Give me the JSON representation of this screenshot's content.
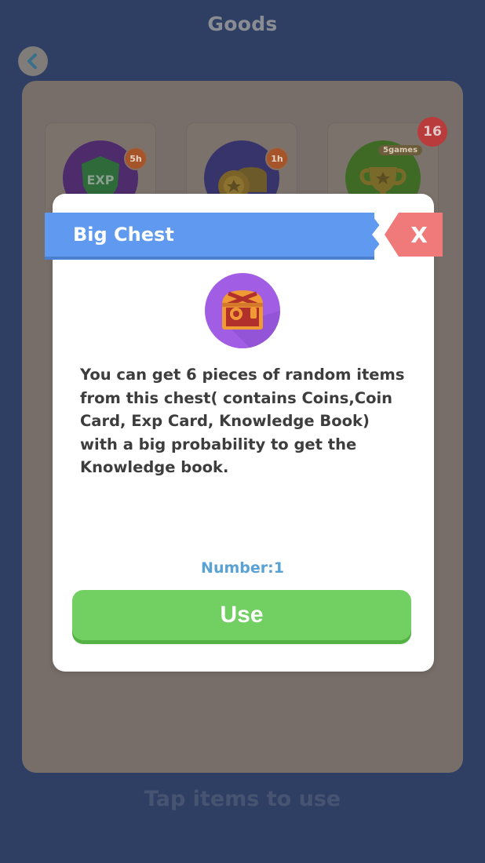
{
  "header": {
    "title": "Goods"
  },
  "goods": [
    {
      "icon": "exp-card-icon",
      "label": "EXP",
      "badge": "5h",
      "color": "#4e2b6a"
    },
    {
      "icon": "coin-card-icon",
      "badge": "1h",
      "color": "#37346b"
    },
    {
      "icon": "trophy-icon",
      "badge": "5games",
      "count": "16",
      "color": "#3f6a26"
    }
  ],
  "modal": {
    "title": "Big Chest",
    "close_label": "X",
    "icon": "treasure-chest-icon",
    "description": "You can get 6 pieces of random items from this chest( contains Coins,Coin Card, Exp Card, Knowledge Book) with a big probability to get the Knowledge book.",
    "number_label": "Number:1",
    "use_label": "Use"
  },
  "footer": {
    "hint": "Tap items to use"
  },
  "colors": {
    "background": "#2f3f63",
    "header_blue": "#5f9af0",
    "close_red": "#f07a7a",
    "use_green": "#72cf62",
    "number_blue": "#5aa2d4"
  }
}
